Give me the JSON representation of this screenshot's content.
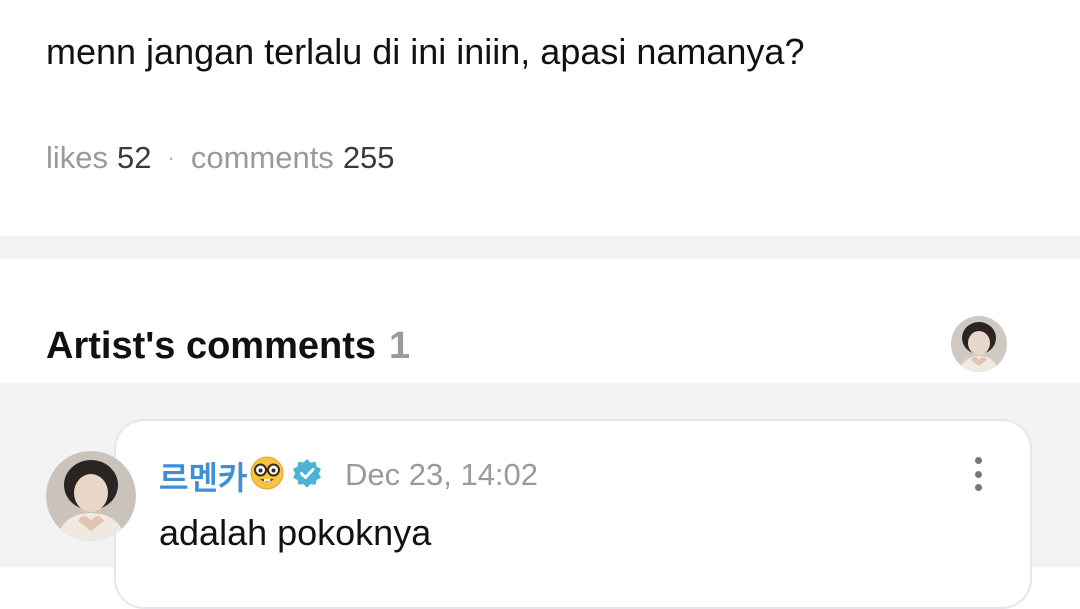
{
  "post": {
    "text": "menn jangan terlalu di ini iniin, apasi namanya?"
  },
  "stats": {
    "likes_label": "likes",
    "likes_count": "52",
    "separator": "·",
    "comments_label": "comments",
    "comments_count": "255"
  },
  "artist_section": {
    "title": "Artist's comments",
    "count": "1"
  },
  "comments": [
    {
      "author": "르멘카",
      "date": "Dec 23, 14:02",
      "text": "adalah pokoknya"
    }
  ],
  "colors": {
    "author": "#3f8fd6",
    "verified": "#4bb4d6",
    "muted": "#9a9a9a",
    "panel": "#f2f3f5"
  },
  "icons": {
    "avatar": "artist-avatar",
    "emoji": "nerd-face-emoji",
    "verified": "verified-badge-icon",
    "more": "more-vertical-icon"
  }
}
